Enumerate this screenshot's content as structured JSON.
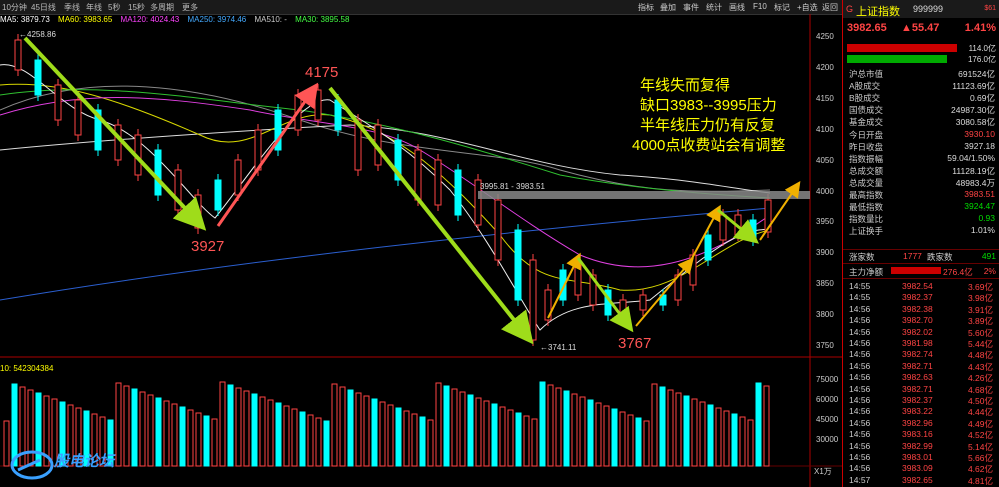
{
  "toolbar": {
    "left": [
      "10分钟",
      "45日线",
      "季线",
      "年线",
      "5秒",
      "15秒",
      "多周期",
      "更多"
    ],
    "right": [
      "指标",
      "叠加",
      "事件",
      "统计",
      "画线",
      "F10",
      "标记",
      "+自选",
      "返回"
    ]
  },
  "ma": {
    "ma5": "MA5: 3879.73",
    "ma10": "MA60: 3983.65",
    "ma120": "MA120: 4024.43",
    "ma250": "MA250: 3974.46",
    "ma510": "MA510: -",
    "ma30": "MA30: 3895.58"
  },
  "vol_label": "10: 542304384",
  "price_axis": [
    "4250",
    "4200",
    "4150",
    "4100",
    "4050",
    "4000",
    "3950",
    "3900",
    "3850",
    "3800",
    "3750"
  ],
  "vol_axis": [
    "75000",
    "60000",
    "45000",
    "30000"
  ],
  "zoom": "X1万",
  "chart_annotations": {
    "high_label": "4258.86",
    "p4175": "4175",
    "p3927": "3927",
    "p3767": "3767",
    "low_label": "3741.11",
    "gap_label": "3995.81 - 3983.51",
    "note_lines": [
      "年线失而复得",
      "缺口3983--3995压力",
      "半年线压力仍有反复",
      "4000点收费站会有调整"
    ]
  },
  "panel": {
    "code_prefix": "G",
    "name": "上证指数",
    "code": "999999",
    "tag": "$61",
    "price": "3982.65",
    "change": "▲55.47",
    "pct": "1.41%",
    "ratio1": "114.0亿",
    "ratio2": "176.0亿",
    "stats": [
      {
        "label": "沪总市值",
        "value": "691524亿",
        "color": "white"
      },
      {
        "label": "A股成交",
        "value": "11123.69亿",
        "color": "white"
      },
      {
        "label": "B股成交",
        "value": "0.69亿",
        "color": "white"
      },
      {
        "label": "国债成交",
        "value": "24987.30亿",
        "color": "white"
      },
      {
        "label": "基金成交",
        "value": "3080.58亿",
        "color": "white"
      },
      {
        "label": "今日开盘",
        "value": "3930.10",
        "color": "red"
      },
      {
        "label": "昨日收盘",
        "value": "3927.18",
        "color": "white"
      },
      {
        "label": "指数振幅",
        "value": "59.04/1.50%",
        "color": "white"
      },
      {
        "label": "总成交额",
        "value": "11128.19亿",
        "color": "white"
      },
      {
        "label": "总成交量",
        "value": "48983.4万",
        "color": "white"
      },
      {
        "label": "最高指数",
        "value": "3983.51",
        "color": "red"
      },
      {
        "label": "最低指数",
        "value": "3924.47",
        "color": "green"
      },
      {
        "label": "指数量比",
        "value": "0.93",
        "color": "green"
      },
      {
        "label": "上证换手",
        "value": "1.01%",
        "color": "white"
      }
    ],
    "up_label": "涨家数",
    "up_count": "1777",
    "down_label": "跌家数",
    "down_count": "491",
    "net_label": "主力净额",
    "net_value": "276.4亿",
    "net_pct": "2%",
    "trades": [
      {
        "t": "14:55",
        "p": "3982.54",
        "v": "3.69亿"
      },
      {
        "t": "14:55",
        "p": "3982.37",
        "v": "3.98亿"
      },
      {
        "t": "14:56",
        "p": "3982.38",
        "v": "3.91亿"
      },
      {
        "t": "14:56",
        "p": "3982.70",
        "v": "3.89亿"
      },
      {
        "t": "14:56",
        "p": "3982.02",
        "v": "5.60亿"
      },
      {
        "t": "14:56",
        "p": "3981.98",
        "v": "5.44亿"
      },
      {
        "t": "14:56",
        "p": "3982.74",
        "v": "4.48亿"
      },
      {
        "t": "14:56",
        "p": "3982.71",
        "v": "4.43亿"
      },
      {
        "t": "14:56",
        "p": "3982.63",
        "v": "4.26亿"
      },
      {
        "t": "14:56",
        "p": "3982.71",
        "v": "4.68亿"
      },
      {
        "t": "14:56",
        "p": "3982.37",
        "v": "4.50亿"
      },
      {
        "t": "14:56",
        "p": "3983.22",
        "v": "4.44亿"
      },
      {
        "t": "14:56",
        "p": "3982.96",
        "v": "4.49亿"
      },
      {
        "t": "14:56",
        "p": "3983.16",
        "v": "4.52亿"
      },
      {
        "t": "14:56",
        "p": "3982.99",
        "v": "5.14亿"
      },
      {
        "t": "14:56",
        "p": "3983.01",
        "v": "5.66亿"
      },
      {
        "t": "14:56",
        "p": "3983.09",
        "v": "4.62亿"
      },
      {
        "t": "14:57",
        "p": "3982.65",
        "v": "4.81亿"
      }
    ]
  },
  "logo_text": "股电论坛"
}
